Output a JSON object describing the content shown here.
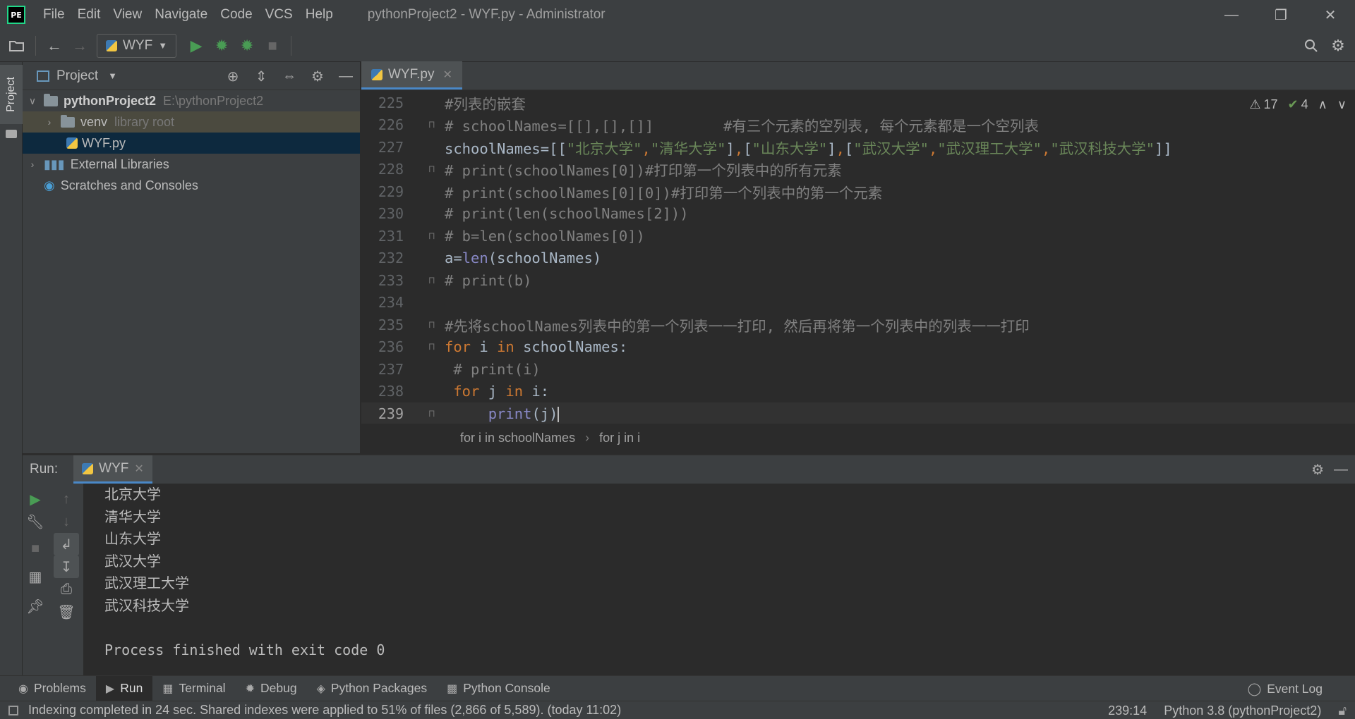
{
  "window": {
    "logo": "PE",
    "title": "pythonProject2 - WYF.py - Administrator",
    "menu": [
      "File",
      "Edit",
      "View",
      "Navigate",
      "Code",
      "VCS",
      "Help"
    ]
  },
  "toolbar": {
    "run_config": "WYF"
  },
  "left_strip": {
    "project_tab": "Project"
  },
  "project_panel": {
    "title": "Project",
    "tree": [
      {
        "label": "pythonProject2",
        "hint": "E:\\pythonProject2"
      },
      {
        "label": "venv",
        "hint": "library root"
      },
      {
        "label": "WYF.py"
      },
      {
        "label": "External Libraries"
      },
      {
        "label": "Scratches and Consoles"
      }
    ]
  },
  "editor": {
    "tab": "WYF.py",
    "warnings": "17",
    "ok_count": "4",
    "lines": [
      {
        "num": "225",
        "segs": [
          {
            "c": "cmt",
            "t": "#列表的嵌套"
          }
        ]
      },
      {
        "num": "226",
        "segs": [
          {
            "c": "cmt",
            "t": "# schoolNames=[[],[],[]]        #有三个元素的空列表, 每个元素都是一个空列表"
          }
        ]
      },
      {
        "num": "227",
        "segs": [
          {
            "c": "id",
            "t": "schoolNames=[["
          },
          {
            "c": "str",
            "t": "\"北京大学\""
          },
          {
            "c": "kw",
            "t": ","
          },
          {
            "c": "str",
            "t": "\"清华大学\""
          },
          {
            "c": "id",
            "t": "]"
          },
          {
            "c": "kw",
            "t": ","
          },
          {
            "c": "id",
            "t": "["
          },
          {
            "c": "str",
            "t": "\"山东大学\""
          },
          {
            "c": "id",
            "t": "]"
          },
          {
            "c": "kw",
            "t": ","
          },
          {
            "c": "id",
            "t": "["
          },
          {
            "c": "str",
            "t": "\"武汉大学\""
          },
          {
            "c": "kw",
            "t": ","
          },
          {
            "c": "str",
            "t": "\"武汉理工大学\""
          },
          {
            "c": "kw",
            "t": ","
          },
          {
            "c": "str",
            "t": "\"武汉科技大学\""
          },
          {
            "c": "id",
            "t": "]]"
          }
        ]
      },
      {
        "num": "228",
        "segs": [
          {
            "c": "cmt",
            "t": "# print(schoolNames[0])#打印第一个列表中的所有元素"
          }
        ]
      },
      {
        "num": "229",
        "segs": [
          {
            "c": "cmt",
            "t": "# print(schoolNames[0][0])#打印第一个列表中的第一个元素"
          }
        ]
      },
      {
        "num": "230",
        "segs": [
          {
            "c": "cmt",
            "t": "# print(len(schoolNames[2]))"
          }
        ]
      },
      {
        "num": "231",
        "segs": [
          {
            "c": "cmt",
            "t": "# b=len(schoolNames[0])"
          }
        ]
      },
      {
        "num": "232",
        "segs": [
          {
            "c": "id",
            "t": "a="
          },
          {
            "c": "bi",
            "t": "len"
          },
          {
            "c": "id",
            "t": "(schoolNames)"
          }
        ]
      },
      {
        "num": "233",
        "segs": [
          {
            "c": "cmt",
            "t": "# print(b)"
          }
        ]
      },
      {
        "num": "234",
        "segs": []
      },
      {
        "num": "235",
        "segs": [
          {
            "c": "cmt",
            "t": "#先将schoolNames列表中的第一个列表一一打印, 然后再将第一个列表中的列表一一打印"
          }
        ]
      },
      {
        "num": "236",
        "segs": [
          {
            "c": "kw",
            "t": "for"
          },
          {
            "c": "id",
            "t": " i "
          },
          {
            "c": "kw",
            "t": "in"
          },
          {
            "c": "id",
            "t": " schoolNames:"
          }
        ]
      },
      {
        "num": "237",
        "segs": [
          {
            "c": "cmt",
            "t": " # print(i)"
          }
        ]
      },
      {
        "num": "238",
        "segs": [
          {
            "c": "id",
            "t": " "
          },
          {
            "c": "kw",
            "t": "for"
          },
          {
            "c": "id",
            "t": " j "
          },
          {
            "c": "kw",
            "t": "in"
          },
          {
            "c": "id",
            "t": " i:"
          }
        ]
      },
      {
        "num": "239",
        "segs": [
          {
            "c": "id",
            "t": "     "
          },
          {
            "c": "bi",
            "t": "print"
          },
          {
            "c": "id",
            "t": "(j)"
          }
        ]
      }
    ],
    "breadcrumb": [
      "for i in schoolNames",
      "for j in i"
    ]
  },
  "run": {
    "label": "Run:",
    "tab": "WYF",
    "output": [
      "北京大学",
      "清华大学",
      "山东大学",
      "武汉大学",
      "武汉理工大学",
      "武汉科技大学",
      "",
      "Process finished with exit code 0"
    ]
  },
  "bottom_tabs": [
    "Problems",
    "Run",
    "Terminal",
    "Debug",
    "Python Packages",
    "Python Console"
  ],
  "event_log": "Event Log",
  "status": {
    "message": "Indexing completed in 24 sec. Shared indexes were applied to 51% of files (2,866 of 5,589). (today 11:02)",
    "position": "239:14",
    "interpreter": "Python 3.8 (pythonProject2)"
  }
}
